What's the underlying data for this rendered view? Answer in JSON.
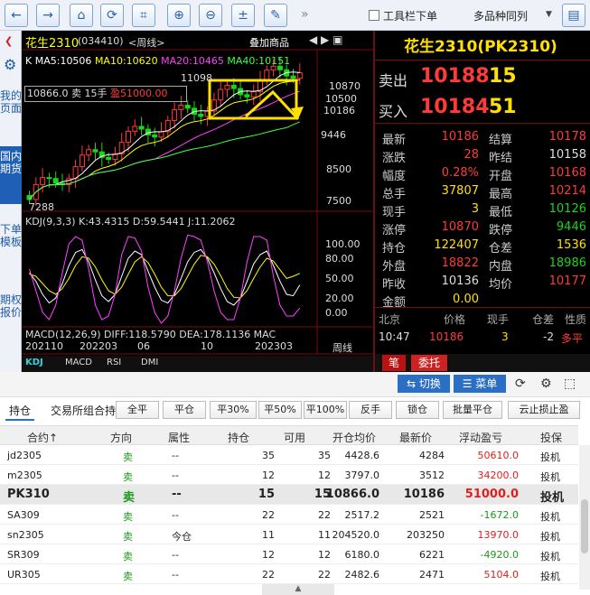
{
  "toolbar": {
    "back_icon": "←",
    "forward_icon": "→",
    "home_icon": "⌂",
    "refresh_icon": "⟳",
    "crop_icon": "⌗",
    "zoom_in_icon": "⊕",
    "zoom_out_icon": "⊖",
    "calc_icon": "±",
    "pen_icon": "✎",
    "more": "»",
    "toolbar_single_row": "工具栏下单",
    "multi_same_column": "多品种同列"
  },
  "left_nav": [
    "我的页面",
    "国内期货",
    "下单模板",
    "期权报价"
  ],
  "chart": {
    "symbol": "花生2310",
    "code": "(034410)",
    "period": "<周线>",
    "overlay": "叠加商品",
    "ma_labels": [
      {
        "text": "K",
        "color": "#ffffff"
      },
      {
        "text": "MA5:10506",
        "color": "#ffffff"
      },
      {
        "text": "MA10:10620",
        "color": "#ffff00"
      },
      {
        "text": "MA20:10465",
        "color": "#ff40ff"
      },
      {
        "text": "MA40:10151",
        "color": "#40ff40"
      }
    ],
    "position_label": "10866.0 卖 15手",
    "profit_label": "盈51000.00",
    "price_labels": [
      "11098",
      "10870",
      "10500",
      "10186",
      "9446",
      "8500",
      "7500",
      "7288"
    ],
    "kdj_label": "KDJ(9,3,3) K:43.4315 D:59.5441 J:11.2062",
    "kdj_axis": [
      "100.00",
      "80.00",
      "50.00",
      "20.00",
      "0.00"
    ],
    "macd_label": "MACD(12,26,9) DIFF:118.5790 DEA:178.1136 MAC",
    "dates": [
      "202110",
      "202203",
      "06",
      "10",
      "202303"
    ],
    "period_tag": "周线",
    "tabs": [
      "KDJ",
      "MACD",
      "RSI",
      "DMI"
    ],
    "kdj_K": [
      60,
      48,
      30,
      18,
      25,
      45,
      70,
      88,
      92,
      75,
      50,
      28,
      20,
      30,
      55,
      80,
      90,
      85,
      62,
      40,
      22,
      18,
      30,
      52,
      75,
      88,
      92,
      80,
      60,
      38,
      20,
      15,
      25,
      48,
      72,
      85,
      90,
      70,
      48,
      30,
      28,
      43
    ],
    "kdj_D": [
      58,
      55,
      45,
      35,
      30,
      38,
      52,
      70,
      82,
      80,
      68,
      50,
      35,
      30,
      40,
      58,
      75,
      82,
      74,
      58,
      40,
      28,
      28,
      38,
      55,
      72,
      84,
      82,
      72,
      56,
      38,
      26,
      25,
      35,
      52,
      68,
      80,
      76,
      64,
      52,
      55,
      59
    ],
    "kdj_J": [
      65,
      35,
      5,
      -5,
      15,
      60,
      100,
      110,
      105,
      65,
      15,
      -5,
      0,
      30,
      85,
      110,
      108,
      90,
      40,
      5,
      -10,
      0,
      35,
      80,
      112,
      110,
      105,
      75,
      35,
      5,
      -5,
      -5,
      25,
      75,
      110,
      110,
      105,
      55,
      15,
      0,
      0,
      11
    ]
  },
  "quote": {
    "title": "花生2310(PK2310)",
    "sell_label": "卖出",
    "sell_price": "10188",
    "sell_vol": "15",
    "buy_label": "买入",
    "buy_price": "10184",
    "buy_vol": "51",
    "rows": [
      {
        "l": "最新",
        "v": "10186",
        "vc": "red",
        "l2": "结算",
        "v2": "10178",
        "v2c": "red"
      },
      {
        "l": "涨跌",
        "v": "28",
        "vc": "red",
        "l2": "昨结",
        "v2": "10158",
        "v2c": "white"
      },
      {
        "l": "幅度",
        "v": "0.28%",
        "vc": "red",
        "l2": "开盘",
        "v2": "10168",
        "v2c": "red"
      },
      {
        "l": "总手",
        "v": "37807",
        "vc": "yellow",
        "l2": "最高",
        "v2": "10214",
        "v2c": "red"
      },
      {
        "l": "现手",
        "v": "3",
        "vc": "yellow",
        "l2": "最低",
        "v2": "10126",
        "v2c": "green"
      },
      {
        "l": "涨停",
        "v": "10870",
        "vc": "red",
        "l2": "跌停",
        "v2": "9446",
        "v2c": "green"
      },
      {
        "l": "持仓",
        "v": "122407",
        "vc": "yellow",
        "l2": "仓差",
        "v2": "1536",
        "v2c": "yellow"
      },
      {
        "l": "外盘",
        "v": "18822",
        "vc": "red",
        "l2": "内盘",
        "v2": "18986",
        "v2c": "green"
      },
      {
        "l": "昨收",
        "v": "10136",
        "vc": "white",
        "l2": "均价",
        "v2": "10177",
        "v2c": "red"
      },
      {
        "l": "金额",
        "v": "0.00",
        "vc": "yellow",
        "l2": "",
        "v2": "",
        "v2c": "white"
      }
    ],
    "tick_headers": [
      "北京",
      "价格",
      "现手",
      "仓差",
      "性质"
    ],
    "tick": {
      "time": "10:47",
      "price": "10186",
      "vol": "3",
      "diff": "-2",
      "nature": "多平"
    },
    "bottom_tabs": [
      "笔",
      "委托"
    ]
  },
  "mid_buttons": {
    "switch": "⇆ 切换",
    "menu": "☰ 菜单"
  },
  "positions": {
    "tabs": [
      "持仓",
      "交易所组合持"
    ],
    "buttons": [
      "全平",
      "平仓",
      "平30%",
      "平50%",
      "平100%",
      "反手",
      "锁仓",
      "批量平仓",
      "云止损止盈"
    ],
    "headers": [
      "合约↑",
      "方向",
      "属性",
      "持仓",
      "可用",
      "开仓均价",
      "最新价",
      "浮动盈亏",
      "投保"
    ],
    "rows": [
      [
        "jd2305",
        "卖",
        "--",
        "35",
        "35",
        "4428.6",
        "4284",
        "50610.0",
        "投机"
      ],
      [
        "m2305",
        "卖",
        "--",
        "12",
        "12",
        "3797.0",
        "3512",
        "34200.0",
        "投机"
      ],
      [
        "PK310",
        "卖",
        "--",
        "15",
        "15",
        "10866.0",
        "10186",
        "51000.0",
        "投机"
      ],
      [
        "SA309",
        "卖",
        "--",
        "22",
        "22",
        "2517.2",
        "2521",
        "-1672.0",
        "投机"
      ],
      [
        "sn2305",
        "卖",
        "今仓",
        "11",
        "11",
        "204520.0",
        "203250",
        "13970.0",
        "投机"
      ],
      [
        "SR309",
        "卖",
        "--",
        "12",
        "12",
        "6180.0",
        "6221",
        "-4920.0",
        "投机"
      ],
      [
        "UR305",
        "卖",
        "--",
        "22",
        "22",
        "2482.6",
        "2471",
        "5104.0",
        "投机"
      ]
    ]
  }
}
